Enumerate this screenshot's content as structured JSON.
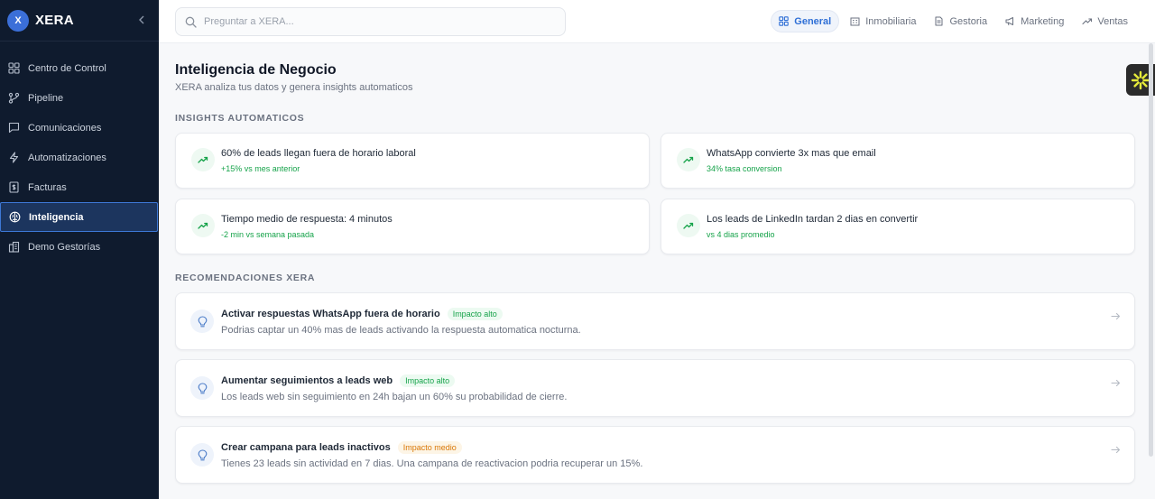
{
  "app": {
    "logo_letter": "X",
    "name": "XERA"
  },
  "sidebar": {
    "items": [
      {
        "label": "Centro de Control",
        "icon": "grid-icon"
      },
      {
        "label": "Pipeline",
        "icon": "git-branch-icon"
      },
      {
        "label": "Comunicaciones",
        "icon": "chat-icon"
      },
      {
        "label": "Automatizaciones",
        "icon": "lightning-icon"
      },
      {
        "label": "Facturas",
        "icon": "invoice-icon"
      },
      {
        "label": "Inteligencia",
        "icon": "brain-icon",
        "active": true
      },
      {
        "label": "Demo Gestorías",
        "icon": "building-icon"
      }
    ]
  },
  "search": {
    "placeholder": "Preguntar a XERA..."
  },
  "tabs": [
    {
      "label": "General",
      "icon": "grid-icon",
      "active": true
    },
    {
      "label": "Inmobiliaria",
      "icon": "building-icon"
    },
    {
      "label": "Gestoria",
      "icon": "document-icon"
    },
    {
      "label": "Marketing",
      "icon": "megaphone-icon"
    },
    {
      "label": "Ventas",
      "icon": "trend-up-icon"
    }
  ],
  "page": {
    "title": "Inteligencia de Negocio",
    "subtitle": "XERA analiza tus datos y genera insights automaticos"
  },
  "insights": {
    "label": "INSIGHTS AUTOMATICOS",
    "items": [
      {
        "title": "60% de leads llegan fuera de horario laboral",
        "meta": "+15% vs mes anterior"
      },
      {
        "title": "WhatsApp convierte 3x mas que email",
        "meta": "34% tasa conversion"
      },
      {
        "title": "Tiempo medio de respuesta: 4 minutos",
        "meta": "-2 min vs semana pasada"
      },
      {
        "title": "Los leads de LinkedIn tardan 2 dias en convertir",
        "meta": "vs 4 dias promedio"
      }
    ]
  },
  "recommendations": {
    "label": "RECOMENDACIONES XERA",
    "items": [
      {
        "title": "Activar respuestas WhatsApp fuera de horario",
        "impact": "Impacto alto",
        "impact_level": "alto",
        "description": "Podrias captar un 40% mas de leads activando la respuesta automatica nocturna."
      },
      {
        "title": "Aumentar seguimientos a leads web",
        "impact": "Impacto alto",
        "impact_level": "alto",
        "description": "Los leads web sin seguimiento en 24h bajan un 60% su probabilidad de cierre."
      },
      {
        "title": "Crear campana para leads inactivos",
        "impact": "Impacto medio",
        "impact_level": "medio",
        "description": "Tienes 23 leads sin actividad en 7 dias. Una campana de reactivacion podria recuperar un 15%."
      }
    ]
  },
  "colors": {
    "sidebar_bg": "#0f1b2e",
    "accent": "#2f6fd6",
    "positive": "#16a34a",
    "warning": "#d97706"
  }
}
